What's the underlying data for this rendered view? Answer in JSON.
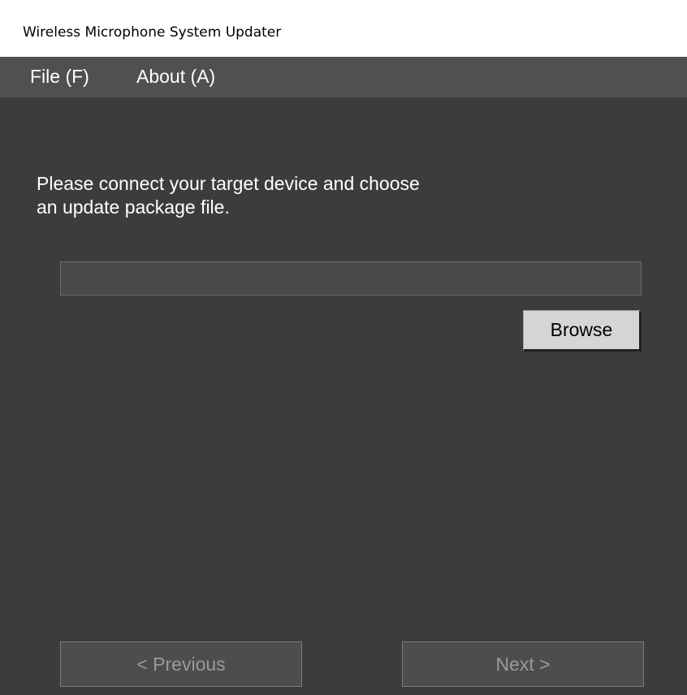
{
  "window": {
    "title": "Wireless Microphone System Updater"
  },
  "menu": {
    "items": [
      {
        "label": "File (F)"
      },
      {
        "label": "About (A)"
      }
    ]
  },
  "main": {
    "instruction_line1": "Please connect your target device and choose",
    "instruction_line2": "an update package file.",
    "file_path_value": "",
    "browse_label": "Browse"
  },
  "footer": {
    "previous_label": "< Previous",
    "next_label": "Next  >"
  },
  "colors": {
    "background": "#3c3c3c",
    "menubar": "#505050",
    "text": "#ffffff",
    "disabled_text": "#9a9a9a"
  }
}
